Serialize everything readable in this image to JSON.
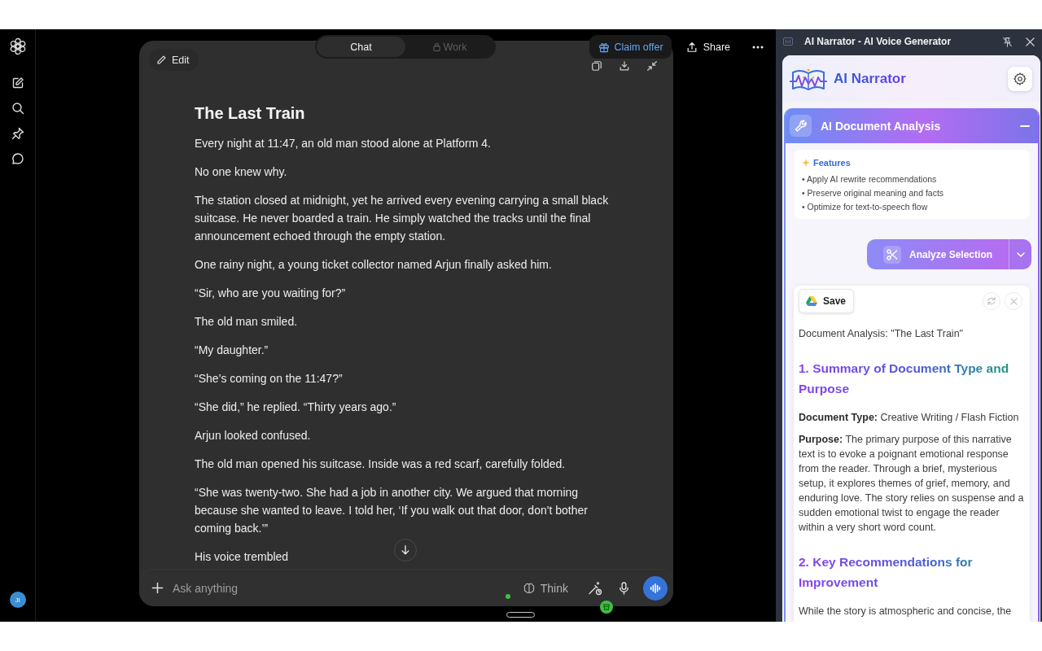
{
  "sidebar": {
    "avatar_initials": "JI"
  },
  "mode_tabs": [
    {
      "label": "Chat",
      "selected": true,
      "locked": false
    },
    {
      "label": "Work",
      "selected": false,
      "locked": true
    }
  ],
  "header_actions": {
    "claim_offer": "Claim offer",
    "share": "Share"
  },
  "chat": {
    "edit_label": "Edit",
    "title": "The Last Train",
    "paragraphs": [
      "Every night at 11:47, an old man stood alone at Platform 4.",
      "No one knew why.",
      "The station closed at midnight, yet he arrived every evening carrying a small black suitcase. He never boarded a train. He simply watched the tracks until the final announcement echoed through the empty station.",
      "One rainy night, a young ticket collector named Arjun finally asked him.",
      "“Sir, who are you waiting for?”",
      "The old man smiled.",
      "“My daughter.”",
      "“She’s coming on the 11:47?”",
      "“She did,” he replied. “Thirty years ago.”",
      "Arjun looked confused.",
      "The old man opened his suitcase. Inside was a red scarf, carefully folded.",
      "“She was twenty-two. She had a job in another city. We argued that morning because she wanted to leave. I told her, ‘If you walk out that door, don't bother coming back.’”",
      "His voice trembled"
    ]
  },
  "composer": {
    "placeholder": "Ask anything",
    "think_label": "Think"
  },
  "narrator": {
    "window_title": "AI Narrator - AI Voice Generator",
    "app_name": "AI Narrator",
    "section": {
      "title": "AI Document Analysis",
      "expanded": true,
      "features_heading": "Features",
      "features": [
        "• Apply AI rewrite recommendations",
        "• Preserve original meaning and facts",
        "• Optimize for text-to-speech flow"
      ]
    },
    "analyze_button": "Analyze Selection",
    "result": {
      "save_label": "Save",
      "blocks": [
        {
          "kind": "text",
          "text": "Document Analysis: \"The Last Train\""
        },
        {
          "kind": "heading",
          "text": "1. Summary of Document Type and Purpose"
        },
        {
          "kind": "text",
          "text": "**Document Type:** Creative Writing / Flash Fiction"
        },
        {
          "kind": "text",
          "text": "**Purpose:** The primary purpose of this narrative text is to evoke a poignant emotional response from the reader. Through a brief, mysterious setup, it explores themes of grief, memory, and enduring love. The story relies on suspense and a sudden emotional twist to engage the reader within a very short word count."
        },
        {
          "kind": "heading",
          "text": "2. Key Recommendations for Improvement"
        },
        {
          "kind": "text",
          "text": "While the story is atmospheric and concise, the"
        }
      ]
    }
  }
}
